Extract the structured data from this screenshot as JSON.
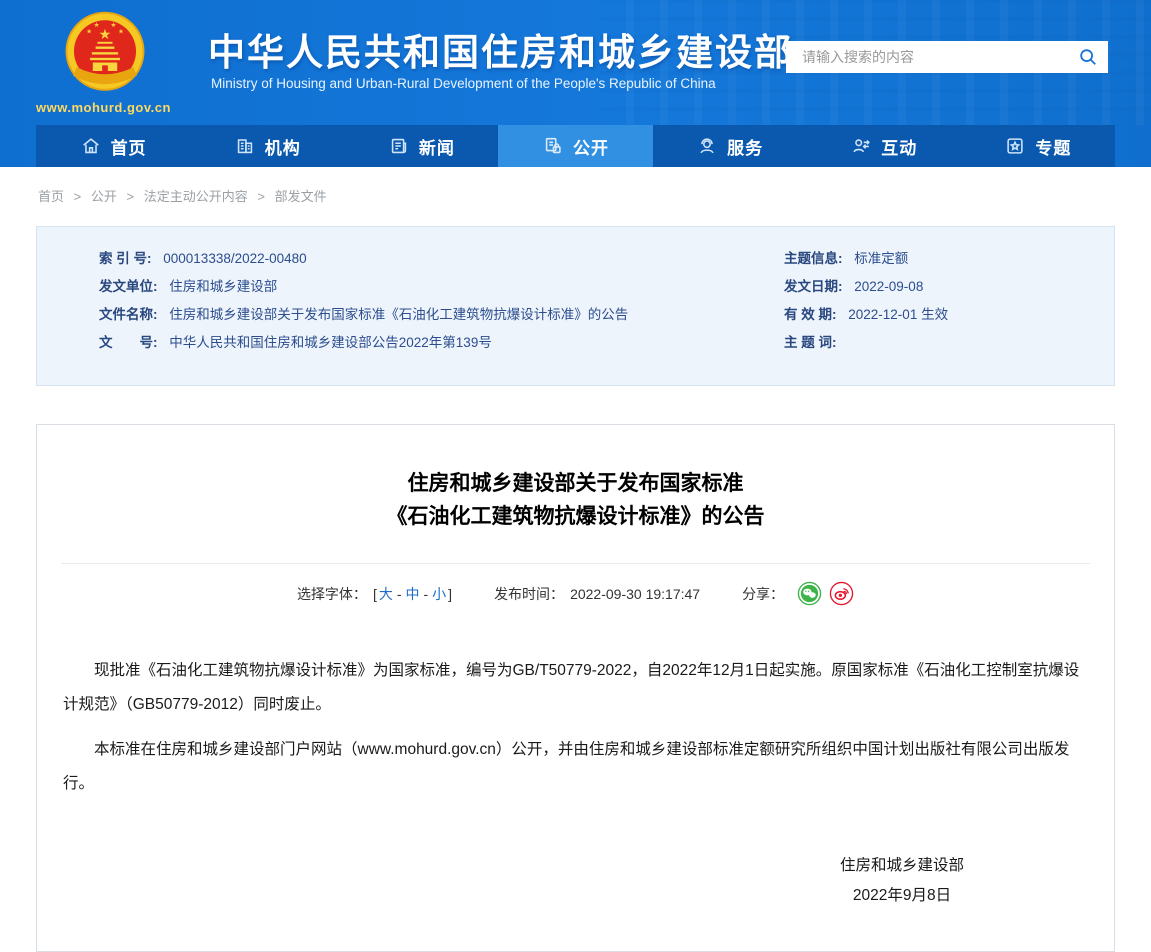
{
  "header": {
    "site_title": "中华人民共和国住房和城乡建设部",
    "site_subtitle": "Ministry of Housing and Urban-Rural Development of the People's Republic of China",
    "site_url": "www.mohurd.gov.cn",
    "search_placeholder": "请输入搜索的内容"
  },
  "nav": {
    "active": "公开",
    "items": [
      {
        "label": "首页"
      },
      {
        "label": "机构"
      },
      {
        "label": "新闻"
      },
      {
        "label": "公开"
      },
      {
        "label": "服务"
      },
      {
        "label": "互动"
      },
      {
        "label": "专题"
      }
    ]
  },
  "breadcrumb": {
    "separator": ">",
    "items": [
      "首页",
      "公开",
      "法定主动公开内容",
      "部发文件"
    ]
  },
  "info_panel": {
    "left": [
      {
        "label": "索 引 号:",
        "value": "000013338/2022-00480"
      },
      {
        "label": "发文单位:",
        "value": "住房和城乡建设部"
      },
      {
        "label": "文件名称:",
        "value": "住房和城乡建设部关于发布国家标准《石油化工建筑物抗爆设计标准》的公告"
      },
      {
        "label": "文　　号:",
        "value": "中华人民共和国住房和城乡建设部公告2022年第139号"
      }
    ],
    "right": [
      {
        "label": "主题信息:",
        "value": "标准定额"
      },
      {
        "label": "发文日期:",
        "value": "2022-09-08"
      },
      {
        "label": "有 效 期:",
        "value": "2022-12-01 生效"
      },
      {
        "label": "主 题 词:",
        "value": ""
      }
    ]
  },
  "article": {
    "title_line1": "住房和城乡建设部关于发布国家标准",
    "title_line2": "《石油化工建筑物抗爆设计标准》的公告",
    "font_selector": {
      "label": "选择字体：",
      "bracket_open": "[",
      "dash": "-",
      "bracket_close": "]",
      "sizes": [
        "大",
        "中",
        "小"
      ]
    },
    "publish_time": {
      "label": "发布时间：",
      "value": "2022-09-30 19:17:47"
    },
    "share": {
      "label": "分享：",
      "icons": [
        "wechat-share-icon",
        "weibo-share-icon"
      ]
    },
    "paragraphs": [
      "现批准《石油化工建筑物抗爆设计标准》为国家标准，编号为GB/T50779-2022，自2022年12月1日起实施。原国家标准《石油化工控制室抗爆设计规范》（GB50779-2012）同时废止。",
      "本标准在住房和城乡建设部门户网站（www.mohurd.gov.cn）公开，并由住房和城乡建设部标准定额研究所组织中国计划出版社有限公司出版发行。"
    ],
    "signature": {
      "org": "住房和城乡建设部",
      "date": "2022年9月8日"
    }
  },
  "colors": {
    "header_blue": "#1172d3",
    "nav_blue": "#0a59af",
    "nav_active_blue": "#3290e2",
    "panel_bg": "#edf4fb",
    "panel_border": "#d6e3f1",
    "navy_text": "#2c4d8e",
    "link_blue": "#1e6cc8",
    "wechat_green": "#3eb348",
    "weibo_red": "#e6162d",
    "emblem_gold": "#e8a50f",
    "emblem_red": "#df271b",
    "url_gold": "#ffd95e"
  }
}
